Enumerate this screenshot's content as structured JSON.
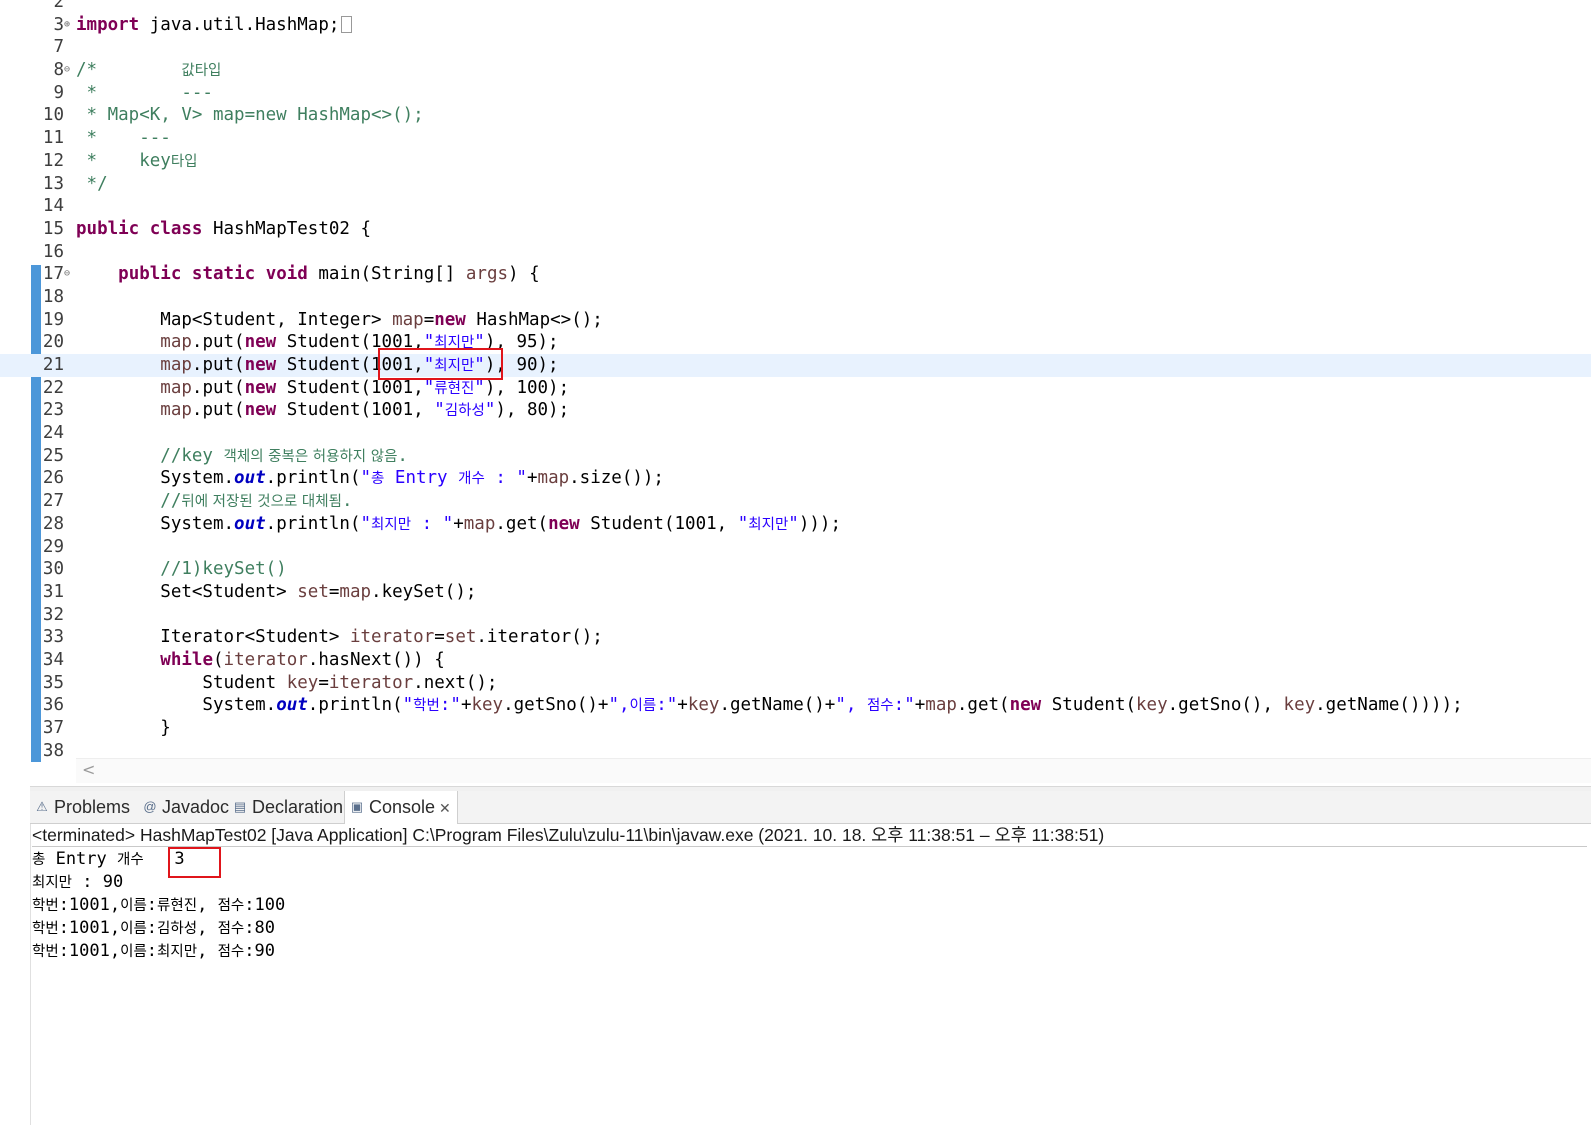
{
  "editor": {
    "lines": [
      {
        "n": "2",
        "parts": []
      },
      {
        "n": "3",
        "fold": "⊕",
        "parts": [
          {
            "t": "import",
            "c": "kw"
          },
          {
            "t": " java.util.HashMap;"
          }
        ],
        "collapsed": true
      },
      {
        "n": "7",
        "parts": []
      },
      {
        "n": "8",
        "fold": "⊖",
        "parts": [
          {
            "t": "/*        ",
            "c": "com"
          },
          {
            "t": "값타입",
            "c": "com ko"
          }
        ]
      },
      {
        "n": "9",
        "parts": [
          {
            "t": " *        ---",
            "c": "com"
          }
        ]
      },
      {
        "n": "10",
        "parts": [
          {
            "t": " * Map<K, V> map=new HashMap<>();",
            "c": "com"
          }
        ]
      },
      {
        "n": "11",
        "parts": [
          {
            "t": " *    ---",
            "c": "com"
          }
        ]
      },
      {
        "n": "12",
        "parts": [
          {
            "t": " *    key",
            "c": "com"
          },
          {
            "t": "타입",
            "c": "com ko"
          }
        ]
      },
      {
        "n": "13",
        "parts": [
          {
            "t": " */",
            "c": "com"
          }
        ]
      },
      {
        "n": "14",
        "parts": []
      },
      {
        "n": "15",
        "parts": [
          {
            "t": "public",
            "c": "kw"
          },
          {
            "t": " "
          },
          {
            "t": "class",
            "c": "kw"
          },
          {
            "t": " HashMapTest02 {"
          }
        ]
      },
      {
        "n": "16",
        "parts": []
      },
      {
        "n": "17",
        "fold": "⊖",
        "parts": [
          {
            "t": "    "
          },
          {
            "t": "public",
            "c": "kw"
          },
          {
            "t": " "
          },
          {
            "t": "static",
            "c": "kw"
          },
          {
            "t": " "
          },
          {
            "t": "void",
            "c": "kw"
          },
          {
            "t": " main(String[] "
          },
          {
            "t": "args",
            "c": "var"
          },
          {
            "t": ") {"
          }
        ]
      },
      {
        "n": "18",
        "parts": []
      },
      {
        "n": "19",
        "parts": [
          {
            "t": "        Map<Student, Integer> "
          },
          {
            "t": "map",
            "c": "var"
          },
          {
            "t": "="
          },
          {
            "t": "new",
            "c": "kw"
          },
          {
            "t": " HashMap<>();"
          }
        ]
      },
      {
        "n": "20",
        "parts": [
          {
            "t": "        "
          },
          {
            "t": "map",
            "c": "var"
          },
          {
            "t": ".put("
          },
          {
            "t": "new",
            "c": "kw"
          },
          {
            "t": " Student(1001,"
          },
          {
            "t": "\"",
            "c": "str"
          },
          {
            "t": "최지만",
            "c": "str ko"
          },
          {
            "t": "\"",
            "c": "str"
          },
          {
            "t": "), 95);"
          }
        ]
      },
      {
        "n": "21",
        "current": true,
        "parts": [
          {
            "t": "        "
          },
          {
            "t": "map",
            "c": "var"
          },
          {
            "t": ".put("
          },
          {
            "t": "new",
            "c": "kw"
          },
          {
            "t": " Student(1001,"
          },
          {
            "t": "\"",
            "c": "str"
          },
          {
            "t": "최지만",
            "c": "str ko"
          },
          {
            "t": "\"",
            "c": "str"
          },
          {
            "t": "), 90);"
          }
        ]
      },
      {
        "n": "22",
        "parts": [
          {
            "t": "        "
          },
          {
            "t": "map",
            "c": "var"
          },
          {
            "t": ".put("
          },
          {
            "t": "new",
            "c": "kw"
          },
          {
            "t": " Student(1001,"
          },
          {
            "t": "\"",
            "c": "str"
          },
          {
            "t": "류현진",
            "c": "str ko"
          },
          {
            "t": "\"",
            "c": "str"
          },
          {
            "t": "), 100);"
          }
        ]
      },
      {
        "n": "23",
        "parts": [
          {
            "t": "        "
          },
          {
            "t": "map",
            "c": "var"
          },
          {
            "t": ".put("
          },
          {
            "t": "new",
            "c": "kw"
          },
          {
            "t": " Student(1001, "
          },
          {
            "t": "\"",
            "c": "str"
          },
          {
            "t": "김하성",
            "c": "str ko"
          },
          {
            "t": "\"",
            "c": "str"
          },
          {
            "t": "), 80);"
          }
        ]
      },
      {
        "n": "24",
        "parts": []
      },
      {
        "n": "25",
        "parts": [
          {
            "t": "        //key ",
            "c": "com"
          },
          {
            "t": "객체의 중복은 허용하지 않음",
            "c": "com ko"
          },
          {
            "t": ".",
            "c": "com"
          }
        ]
      },
      {
        "n": "26",
        "parts": [
          {
            "t": "        System."
          },
          {
            "t": "out",
            "c": "fld"
          },
          {
            "t": ".println("
          },
          {
            "t": "\"",
            "c": "str"
          },
          {
            "t": "총",
            "c": "str ko"
          },
          {
            "t": " Entry ",
            "c": "str"
          },
          {
            "t": "개수",
            "c": "str ko"
          },
          {
            "t": " : \"",
            "c": "str"
          },
          {
            "t": "+"
          },
          {
            "t": "map",
            "c": "var"
          },
          {
            "t": ".size());"
          }
        ]
      },
      {
        "n": "27",
        "parts": [
          {
            "t": "        //",
            "c": "com"
          },
          {
            "t": "뒤에 저장된 것으로 대체됨",
            "c": "com ko"
          },
          {
            "t": ".",
            "c": "com"
          }
        ]
      },
      {
        "n": "28",
        "parts": [
          {
            "t": "        System."
          },
          {
            "t": "out",
            "c": "fld"
          },
          {
            "t": ".println("
          },
          {
            "t": "\"",
            "c": "str"
          },
          {
            "t": "최지만",
            "c": "str ko"
          },
          {
            "t": " : \"",
            "c": "str"
          },
          {
            "t": "+"
          },
          {
            "t": "map",
            "c": "var"
          },
          {
            "t": ".get("
          },
          {
            "t": "new",
            "c": "kw"
          },
          {
            "t": " Student(1001, "
          },
          {
            "t": "\"",
            "c": "str"
          },
          {
            "t": "최지만",
            "c": "str ko"
          },
          {
            "t": "\"",
            "c": "str"
          },
          {
            "t": ")));"
          }
        ]
      },
      {
        "n": "29",
        "parts": []
      },
      {
        "n": "30",
        "parts": [
          {
            "t": "        //1)keySet()",
            "c": "com"
          }
        ]
      },
      {
        "n": "31",
        "parts": [
          {
            "t": "        Set<Student> "
          },
          {
            "t": "set",
            "c": "var"
          },
          {
            "t": "="
          },
          {
            "t": "map",
            "c": "var"
          },
          {
            "t": ".keySet();"
          }
        ]
      },
      {
        "n": "32",
        "parts": []
      },
      {
        "n": "33",
        "parts": [
          {
            "t": "        Iterator<Student> "
          },
          {
            "t": "iterator",
            "c": "var"
          },
          {
            "t": "="
          },
          {
            "t": "set",
            "c": "var"
          },
          {
            "t": ".iterator();"
          }
        ]
      },
      {
        "n": "34",
        "parts": [
          {
            "t": "        "
          },
          {
            "t": "while",
            "c": "kw"
          },
          {
            "t": "("
          },
          {
            "t": "iterator",
            "c": "var"
          },
          {
            "t": ".hasNext()) {"
          }
        ]
      },
      {
        "n": "35",
        "parts": [
          {
            "t": "            Student "
          },
          {
            "t": "key",
            "c": "var"
          },
          {
            "t": "="
          },
          {
            "t": "iterator",
            "c": "var"
          },
          {
            "t": ".next();"
          }
        ]
      },
      {
        "n": "36",
        "parts": [
          {
            "t": "            System."
          },
          {
            "t": "out",
            "c": "fld"
          },
          {
            "t": ".println("
          },
          {
            "t": "\"",
            "c": "str"
          },
          {
            "t": "학번",
            "c": "str ko"
          },
          {
            "t": ":\"",
            "c": "str"
          },
          {
            "t": "+"
          },
          {
            "t": "key",
            "c": "var"
          },
          {
            "t": ".getSno()+"
          },
          {
            "t": "\",",
            "c": "str"
          },
          {
            "t": "이름",
            "c": "str ko"
          },
          {
            "t": ":\"",
            "c": "str"
          },
          {
            "t": "+"
          },
          {
            "t": "key",
            "c": "var"
          },
          {
            "t": ".getName()+"
          },
          {
            "t": "\", ",
            "c": "str"
          },
          {
            "t": "점수",
            "c": "str ko"
          },
          {
            "t": ":\"",
            "c": "str"
          },
          {
            "t": "+"
          },
          {
            "t": "map",
            "c": "var"
          },
          {
            "t": ".get("
          },
          {
            "t": "new",
            "c": "kw"
          },
          {
            "t": " Student("
          },
          {
            "t": "key",
            "c": "var"
          },
          {
            "t": ".getSno(), "
          },
          {
            "t": "key",
            "c": "var"
          },
          {
            "t": ".getName())));"
          }
        ]
      },
      {
        "n": "37",
        "parts": [
          {
            "t": "        }"
          }
        ]
      },
      {
        "n": "38",
        "parts": []
      }
    ],
    "scroll_left_arrow": "<"
  },
  "panel": {
    "tabs": [
      {
        "id": "problems",
        "icon": "⚠",
        "label": "Problems"
      },
      {
        "id": "javadoc",
        "icon": "@",
        "label": "Javadoc"
      },
      {
        "id": "declaration",
        "icon": "▤",
        "label": "Declaration"
      },
      {
        "id": "console",
        "icon": "▣",
        "label": "Console",
        "active": true,
        "close": "✕"
      }
    ],
    "status": "<terminated> HashMapTest02 [Java Application] C:\\Program Files\\Zulu\\zulu-11\\bin\\javaw.exe  (2021. 10. 18. 오후 11:38:51 – 오후 11:38:51)",
    "output": [
      [
        {
          "t": "총",
          "ko": true
        },
        {
          "t": " Entry "
        },
        {
          "t": "개수",
          "ko": true
        },
        {
          "t": "   3"
        }
      ],
      [
        {
          "t": "최지만",
          "ko": true
        },
        {
          "t": " : 90"
        }
      ],
      [
        {
          "t": "학번",
          "ko": true
        },
        {
          "t": ":1001,"
        },
        {
          "t": "이름",
          "ko": true
        },
        {
          "t": ":"
        },
        {
          "t": "류현진",
          "ko": true
        },
        {
          "t": ", "
        },
        {
          "t": "점수",
          "ko": true
        },
        {
          "t": ":100"
        }
      ],
      [
        {
          "t": "학번",
          "ko": true
        },
        {
          "t": ":1001,"
        },
        {
          "t": "이름",
          "ko": true
        },
        {
          "t": ":"
        },
        {
          "t": "김하성",
          "ko": true
        },
        {
          "t": ", "
        },
        {
          "t": "점수",
          "ko": true
        },
        {
          "t": ":80"
        }
      ],
      [
        {
          "t": "학번",
          "ko": true
        },
        {
          "t": ":1001,"
        },
        {
          "t": "이름",
          "ko": true
        },
        {
          "t": ":"
        },
        {
          "t": "최지만",
          "ko": true
        },
        {
          "t": ", "
        },
        {
          "t": "점수",
          "ko": true
        },
        {
          "t": ":90"
        }
      ]
    ]
  },
  "colors": {
    "keyword": "#7f0055",
    "string": "#2a00ff",
    "comment": "#3f7f5f",
    "field": "#0000c0",
    "local_var": "#6a3e3e",
    "current_line": "#e8f2fe",
    "annotation_box": "#e0151b"
  }
}
